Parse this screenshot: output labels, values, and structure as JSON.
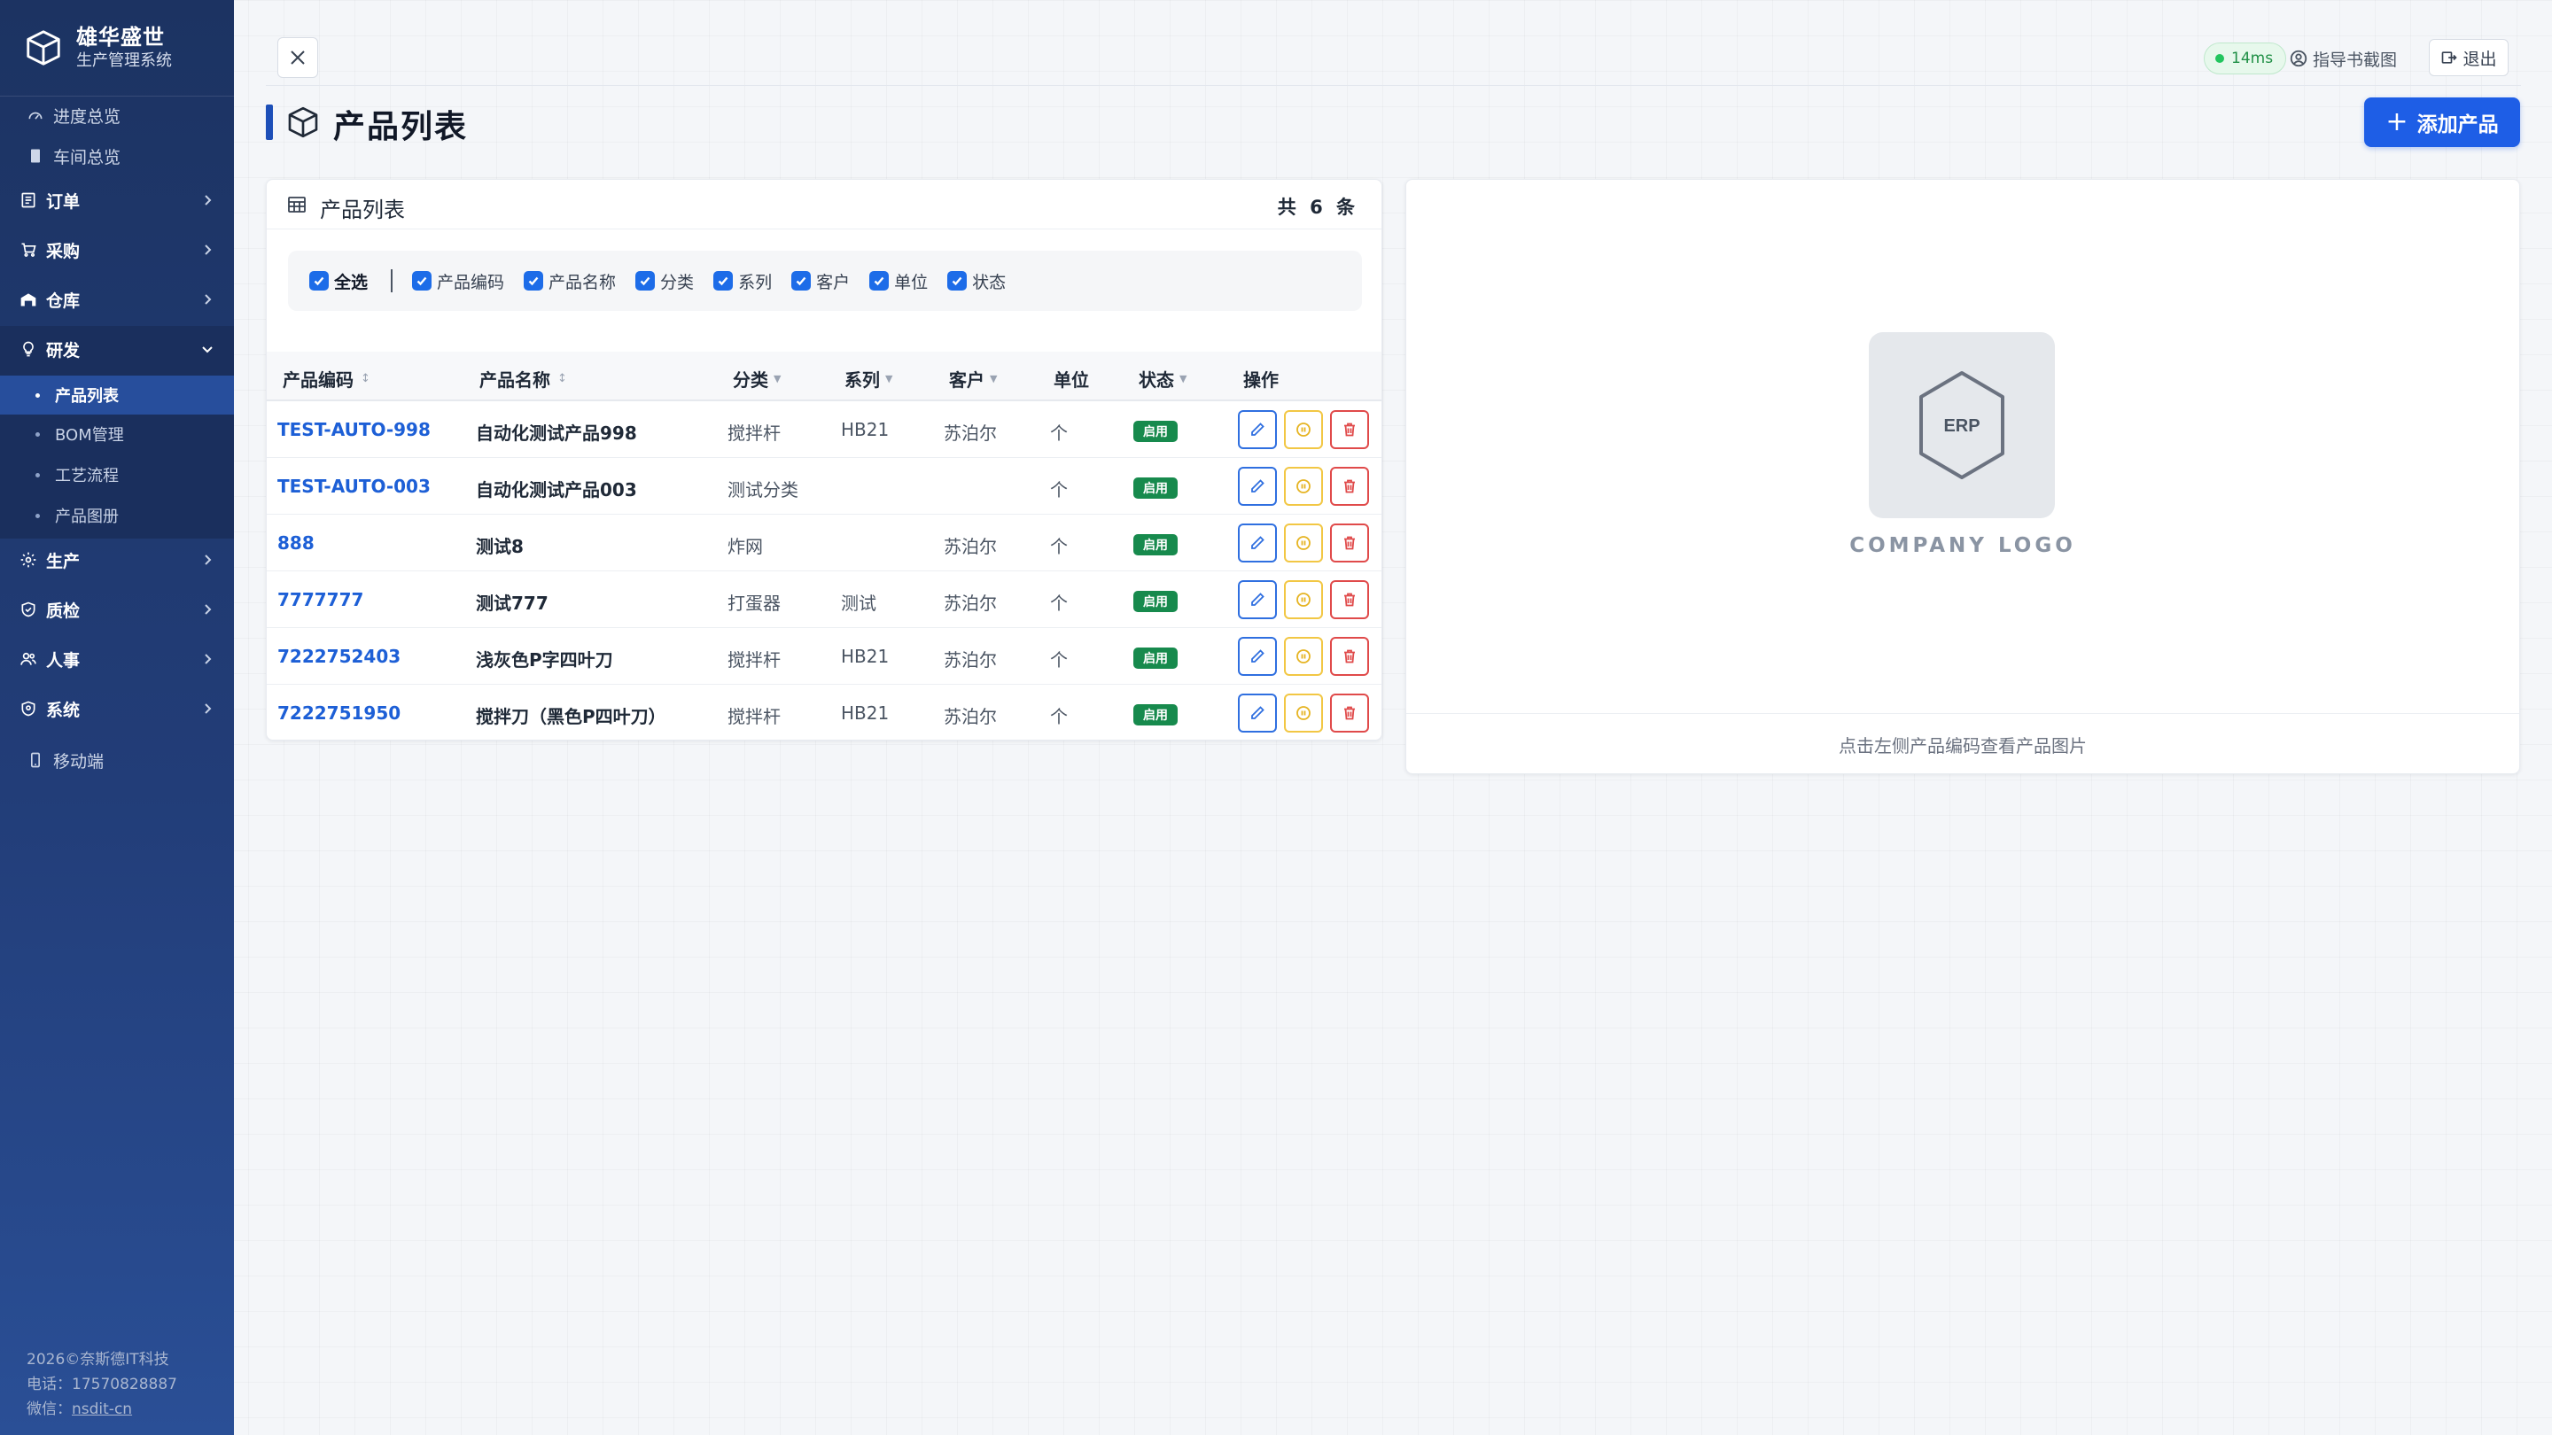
{
  "brand": {
    "name": "雄华盛世",
    "subtitle": "生产管理系统"
  },
  "sidebar": {
    "top_links": [
      {
        "label": "进度总览",
        "icon": "gauge-icon"
      },
      {
        "label": "车间总览",
        "icon": "document-icon"
      }
    ],
    "groups": [
      {
        "label": "订单",
        "icon": "receipt-icon",
        "expanded": false
      },
      {
        "label": "采购",
        "icon": "cart-icon",
        "expanded": false
      },
      {
        "label": "仓库",
        "icon": "warehouse-icon",
        "expanded": false
      },
      {
        "label": "研发",
        "icon": "lightbulb-icon",
        "expanded": true
      },
      {
        "label": "生产",
        "icon": "gear-icon",
        "expanded": false
      },
      {
        "label": "质检",
        "icon": "shield-check-icon",
        "expanded": false
      },
      {
        "label": "人事",
        "icon": "people-icon",
        "expanded": false
      },
      {
        "label": "系统",
        "icon": "shield-icon",
        "expanded": false
      }
    ],
    "rd_items": [
      {
        "label": "产品列表",
        "active": true
      },
      {
        "label": "BOM管理",
        "active": false
      },
      {
        "label": "工艺流程",
        "active": false
      },
      {
        "label": "产品图册",
        "active": false
      }
    ],
    "mobile": {
      "label": "移动端",
      "icon": "phone-icon"
    },
    "footer": {
      "copyright": "2026©奈斯德IT科技",
      "phone": "电话：17570828887",
      "wechat_label": "微信：",
      "wechat": "nsdit-cn"
    }
  },
  "topbar": {
    "latency": "14ms",
    "manual_label": "指导书截图",
    "logout_label": "退出"
  },
  "page": {
    "title": "产品列表",
    "add_button_label": "添加产品"
  },
  "list": {
    "title": "产品列表",
    "count_label": "共 6 条",
    "column_toggles": [
      {
        "label": "全选",
        "checked": true
      },
      {
        "label": "产品编码",
        "checked": true
      },
      {
        "label": "产品名称",
        "checked": true
      },
      {
        "label": "分类",
        "checked": true
      },
      {
        "label": "系列",
        "checked": true
      },
      {
        "label": "客户",
        "checked": true
      },
      {
        "label": "单位",
        "checked": true
      },
      {
        "label": "状态",
        "checked": true
      }
    ],
    "columns": [
      "产品编码",
      "产品名称",
      "分类",
      "系列",
      "客户",
      "单位",
      "状态",
      "操作"
    ],
    "rows": [
      {
        "code": "TEST-AUTO-998",
        "name": "自动化测试产品998",
        "category": "搅拌杆",
        "series": "HB21",
        "customer": "苏泊尔",
        "unit": "个",
        "status": "启用"
      },
      {
        "code": "TEST-AUTO-003",
        "name": "自动化测试产品003",
        "category": "测试分类",
        "series": "",
        "customer": "",
        "unit": "个",
        "status": "启用"
      },
      {
        "code": "888",
        "name": "测试8",
        "category": "炸网",
        "series": "",
        "customer": "苏泊尔",
        "unit": "个",
        "status": "启用"
      },
      {
        "code": "7777777",
        "name": "测试777",
        "category": "打蛋器",
        "series": "测试",
        "customer": "苏泊尔",
        "unit": "个",
        "status": "启用"
      },
      {
        "code": "7222752403",
        "name": "浅灰色P字四叶刀",
        "category": "搅拌杆",
        "series": "HB21",
        "customer": "苏泊尔",
        "unit": "个",
        "status": "启用"
      },
      {
        "code": "7222751950",
        "name": "搅拌刀（黑色P四叶刀）",
        "category": "搅拌杆",
        "series": "HB21",
        "customer": "苏泊尔",
        "unit": "个",
        "status": "启用"
      }
    ]
  },
  "preview": {
    "logo_text": "ERP",
    "logo_caption": "COMPANY LOGO",
    "hint": "点击左侧产品编码查看产品图片"
  },
  "colors": {
    "sidebar_top": "#1c3362",
    "sidebar_bottom": "#2a4f96",
    "primary": "#1e5ee6",
    "link": "#1d5fd6",
    "status_green": "#178a4d",
    "edit_blue": "#2f6fe0",
    "toggle_yellow": "#f2c744",
    "delete_red": "#e04a4a"
  }
}
